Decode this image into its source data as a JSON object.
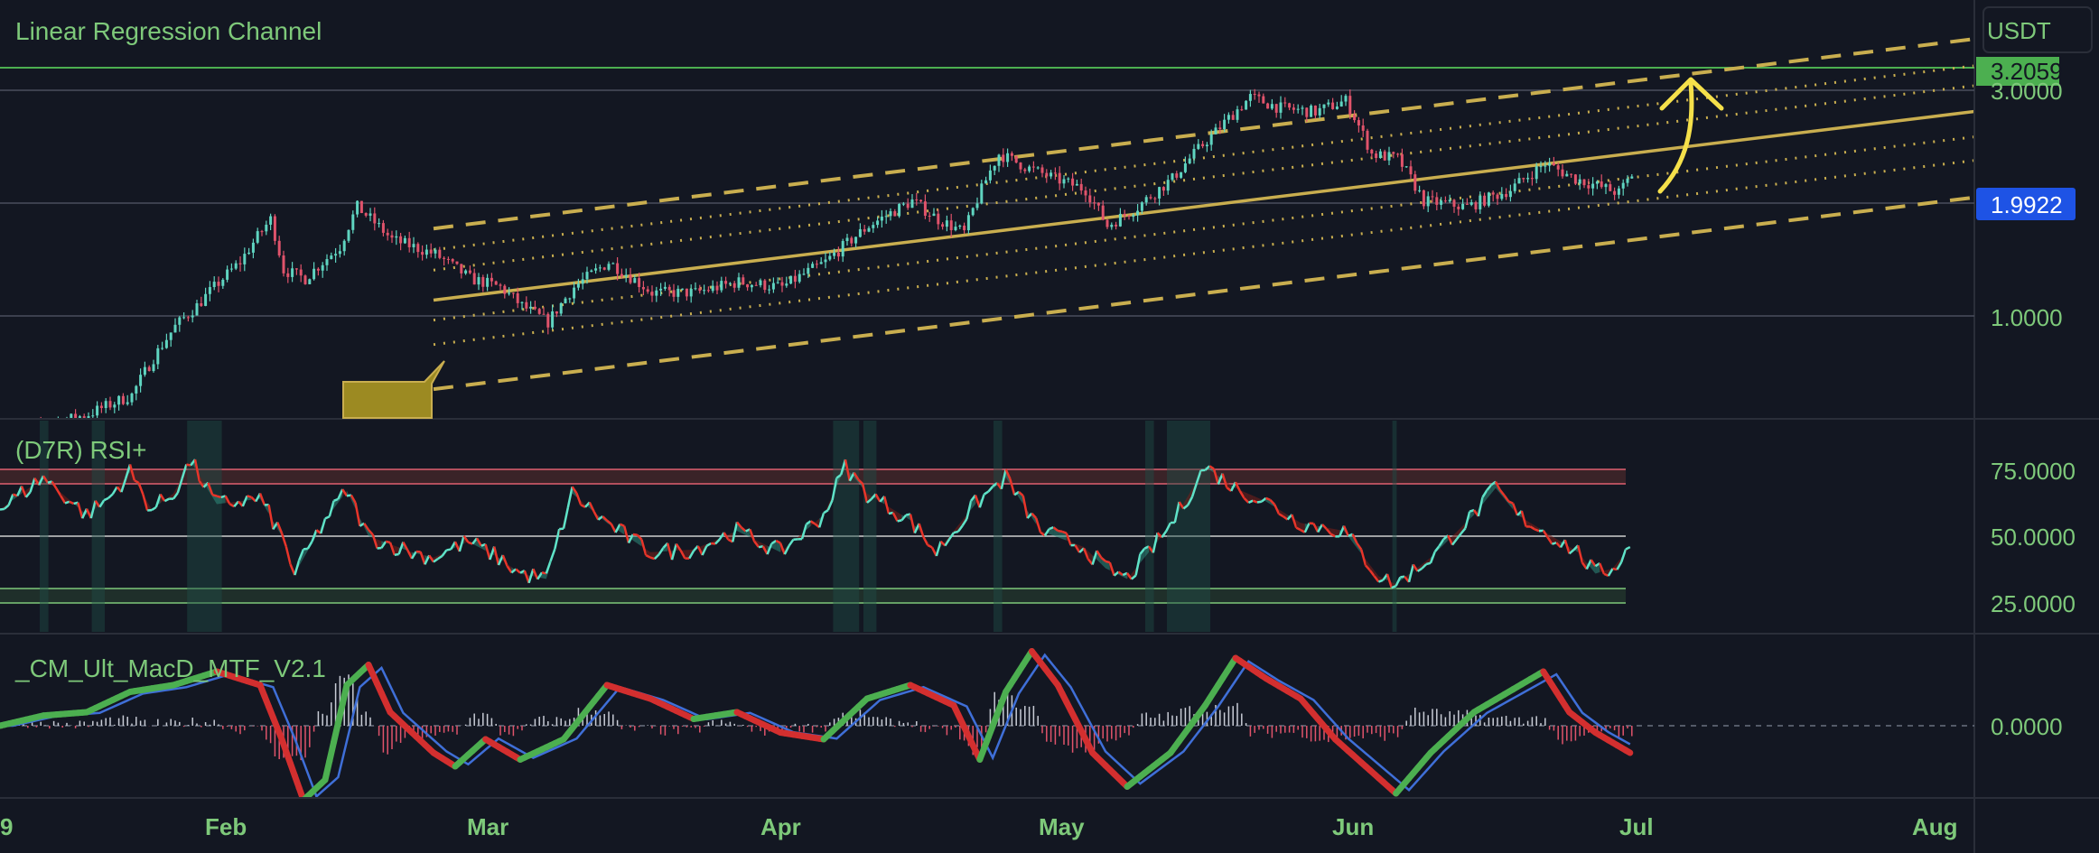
{
  "colors": {
    "background": "#131722",
    "grid": "#4a4f5c",
    "text_green": "#7ec97a",
    "channel_gold": "#c9ae4f",
    "candle_up": "#5fd4c0",
    "candle_down": "#e0536b",
    "rsi_up": "#5fe3c8",
    "rsi_down": "#e8352a",
    "rsi_ob": "#e06070",
    "rsi_os": "#7ec97a",
    "macd_fast": "#4caf50",
    "macd_slow": "#d32f2f",
    "macd_signal": "#3f6fd8",
    "label_price_bg": "#1e53e5",
    "label_top_bg": "#4caf50",
    "arrow_yellow": "#f5e04a"
  },
  "price_axis": {
    "currency": "USDT",
    "ticks": [
      "3.0000",
      "1.0000"
    ],
    "current_price_label": "1.9922",
    "resistance_label": "3.2059"
  },
  "rsi_axis": {
    "ticks": [
      "75.0000",
      "50.0000",
      "25.0000"
    ]
  },
  "macd_axis": {
    "ticks": [
      "0.0000"
    ]
  },
  "time_axis": {
    "labels": [
      "9",
      "Feb",
      "Mar",
      "Apr",
      "May",
      "Jun",
      "Jul",
      "Aug"
    ]
  },
  "chart_data": [
    {
      "type": "candlestick",
      "title": "Linear Regression Channel",
      "y_scale": "log",
      "resistance_level": 3.2059,
      "last_price": 1.9922,
      "price_path": [
        [
          0,
          0.55
        ],
        [
          20,
          0.62
        ],
        [
          30,
          0.68
        ],
        [
          40,
          0.95
        ],
        [
          45,
          1.05
        ],
        [
          55,
          1.3
        ],
        [
          62,
          1.6
        ],
        [
          65,
          1.25
        ],
        [
          70,
          1.2
        ],
        [
          78,
          1.4
        ],
        [
          82,
          1.7
        ],
        [
          90,
          1.45
        ],
        [
          100,
          1.35
        ],
        [
          108,
          1.2
        ],
        [
          115,
          1.15
        ],
        [
          120,
          1.05
        ],
        [
          126,
          0.97
        ],
        [
          132,
          1.15
        ],
        [
          140,
          1.3
        ],
        [
          150,
          1.12
        ],
        [
          160,
          1.12
        ],
        [
          170,
          1.18
        ],
        [
          180,
          1.15
        ],
        [
          190,
          1.3
        ],
        [
          200,
          1.55
        ],
        [
          210,
          1.75
        ],
        [
          216,
          1.6
        ],
        [
          222,
          1.5
        ],
        [
          230,
          2.2
        ],
        [
          237,
          2.05
        ],
        [
          243,
          1.95
        ],
        [
          250,
          1.85
        ],
        [
          255,
          1.55
        ],
        [
          262,
          1.7
        ],
        [
          270,
          1.95
        ],
        [
          280,
          2.45
        ],
        [
          288,
          2.9
        ],
        [
          295,
          2.75
        ],
        [
          303,
          2.7
        ],
        [
          310,
          2.85
        ],
        [
          316,
          2.2
        ],
        [
          322,
          2.15
        ],
        [
          328,
          1.75
        ],
        [
          338,
          1.7
        ],
        [
          348,
          1.85
        ],
        [
          356,
          2.1
        ],
        [
          363,
          1.95
        ],
        [
          373,
          1.82
        ],
        [
          376,
          1.99
        ]
      ],
      "regression_channel": {
        "x_range": [
          100,
          440
        ],
        "center": [
          1.08,
          2.6
        ],
        "upper": [
          1.53,
          3.7
        ],
        "lower": [
          0.7,
          1.71
        ],
        "inner_bands_upper": [
          1.38,
          3.25
        ],
        "inner_bands_mid_upper": [
          1.25,
          2.95
        ],
        "inner_bands_mid_lower": [
          0.98,
          2.3
        ],
        "inner_bands_lower": [
          0.87,
          2.05
        ]
      }
    },
    {
      "type": "line",
      "title": "(D7R) RSI+",
      "ylim": [
        20,
        80
      ],
      "levels": [
        75,
        70,
        50,
        30,
        25
      ],
      "rsi_path": [
        [
          0,
          60
        ],
        [
          10,
          72
        ],
        [
          20,
          58
        ],
        [
          25,
          64
        ],
        [
          30,
          74
        ],
        [
          35,
          60
        ],
        [
          40,
          66
        ],
        [
          44,
          78
        ],
        [
          50,
          62
        ],
        [
          60,
          64
        ],
        [
          65,
          50
        ],
        [
          68,
          36
        ],
        [
          75,
          56
        ],
        [
          80,
          67
        ],
        [
          85,
          50
        ],
        [
          95,
          44
        ],
        [
          100,
          42
        ],
        [
          108,
          48
        ],
        [
          115,
          42
        ],
        [
          120,
          36
        ],
        [
          126,
          34
        ],
        [
          132,
          66
        ],
        [
          140,
          55
        ],
        [
          150,
          44
        ],
        [
          160,
          45
        ],
        [
          170,
          52
        ],
        [
          180,
          44
        ],
        [
          190,
          58
        ],
        [
          195,
          76
        ],
        [
          200,
          66
        ],
        [
          210,
          56
        ],
        [
          216,
          44
        ],
        [
          225,
          62
        ],
        [
          232,
          72
        ],
        [
          240,
          52
        ],
        [
          250,
          46
        ],
        [
          255,
          38
        ],
        [
          260,
          34
        ],
        [
          270,
          54
        ],
        [
          278,
          76
        ],
        [
          285,
          68
        ],
        [
          292,
          63
        ],
        [
          300,
          55
        ],
        [
          310,
          52
        ],
        [
          318,
          35
        ],
        [
          322,
          32
        ],
        [
          330,
          42
        ],
        [
          340,
          58
        ],
        [
          345,
          68
        ],
        [
          350,
          58
        ],
        [
          356,
          52
        ],
        [
          364,
          44
        ],
        [
          368,
          36
        ],
        [
          372,
          38
        ],
        [
          376,
          46
        ]
      ]
    },
    {
      "type": "line",
      "title": "_CM_Ult_MacD_MTF_V2.1",
      "zero_level": 0,
      "macd_path": [
        [
          0,
          0
        ],
        [
          10,
          0.15
        ],
        [
          20,
          0.2
        ],
        [
          30,
          0.5
        ],
        [
          40,
          0.6
        ],
        [
          50,
          0.8
        ],
        [
          60,
          0.6
        ],
        [
          65,
          -0.2
        ],
        [
          70,
          -1.1
        ],
        [
          75,
          -0.8
        ],
        [
          80,
          0.6
        ],
        [
          85,
          0.9
        ],
        [
          90,
          0.2
        ],
        [
          100,
          -0.4
        ],
        [
          105,
          -0.6
        ],
        [
          112,
          -0.2
        ],
        [
          120,
          -0.5
        ],
        [
          130,
          -0.2
        ],
        [
          140,
          0.6
        ],
        [
          150,
          0.4
        ],
        [
          160,
          0.1
        ],
        [
          170,
          0.2
        ],
        [
          180,
          -0.1
        ],
        [
          190,
          -0.2
        ],
        [
          200,
          0.4
        ],
        [
          210,
          0.6
        ],
        [
          220,
          0.3
        ],
        [
          226,
          -0.5
        ],
        [
          232,
          0.5
        ],
        [
          238,
          1.1
        ],
        [
          244,
          0.6
        ],
        [
          252,
          -0.4
        ],
        [
          260,
          -0.9
        ],
        [
          270,
          -0.4
        ],
        [
          278,
          0.3
        ],
        [
          285,
          1.0
        ],
        [
          292,
          0.7
        ],
        [
          300,
          0.4
        ],
        [
          308,
          -0.2
        ],
        [
          315,
          -0.6
        ],
        [
          322,
          -1.0
        ],
        [
          330,
          -0.4
        ],
        [
          340,
          0.2
        ],
        [
          348,
          0.5
        ],
        [
          356,
          0.8
        ],
        [
          362,
          0.2
        ],
        [
          368,
          -0.1
        ],
        [
          376,
          -0.4
        ]
      ]
    }
  ]
}
